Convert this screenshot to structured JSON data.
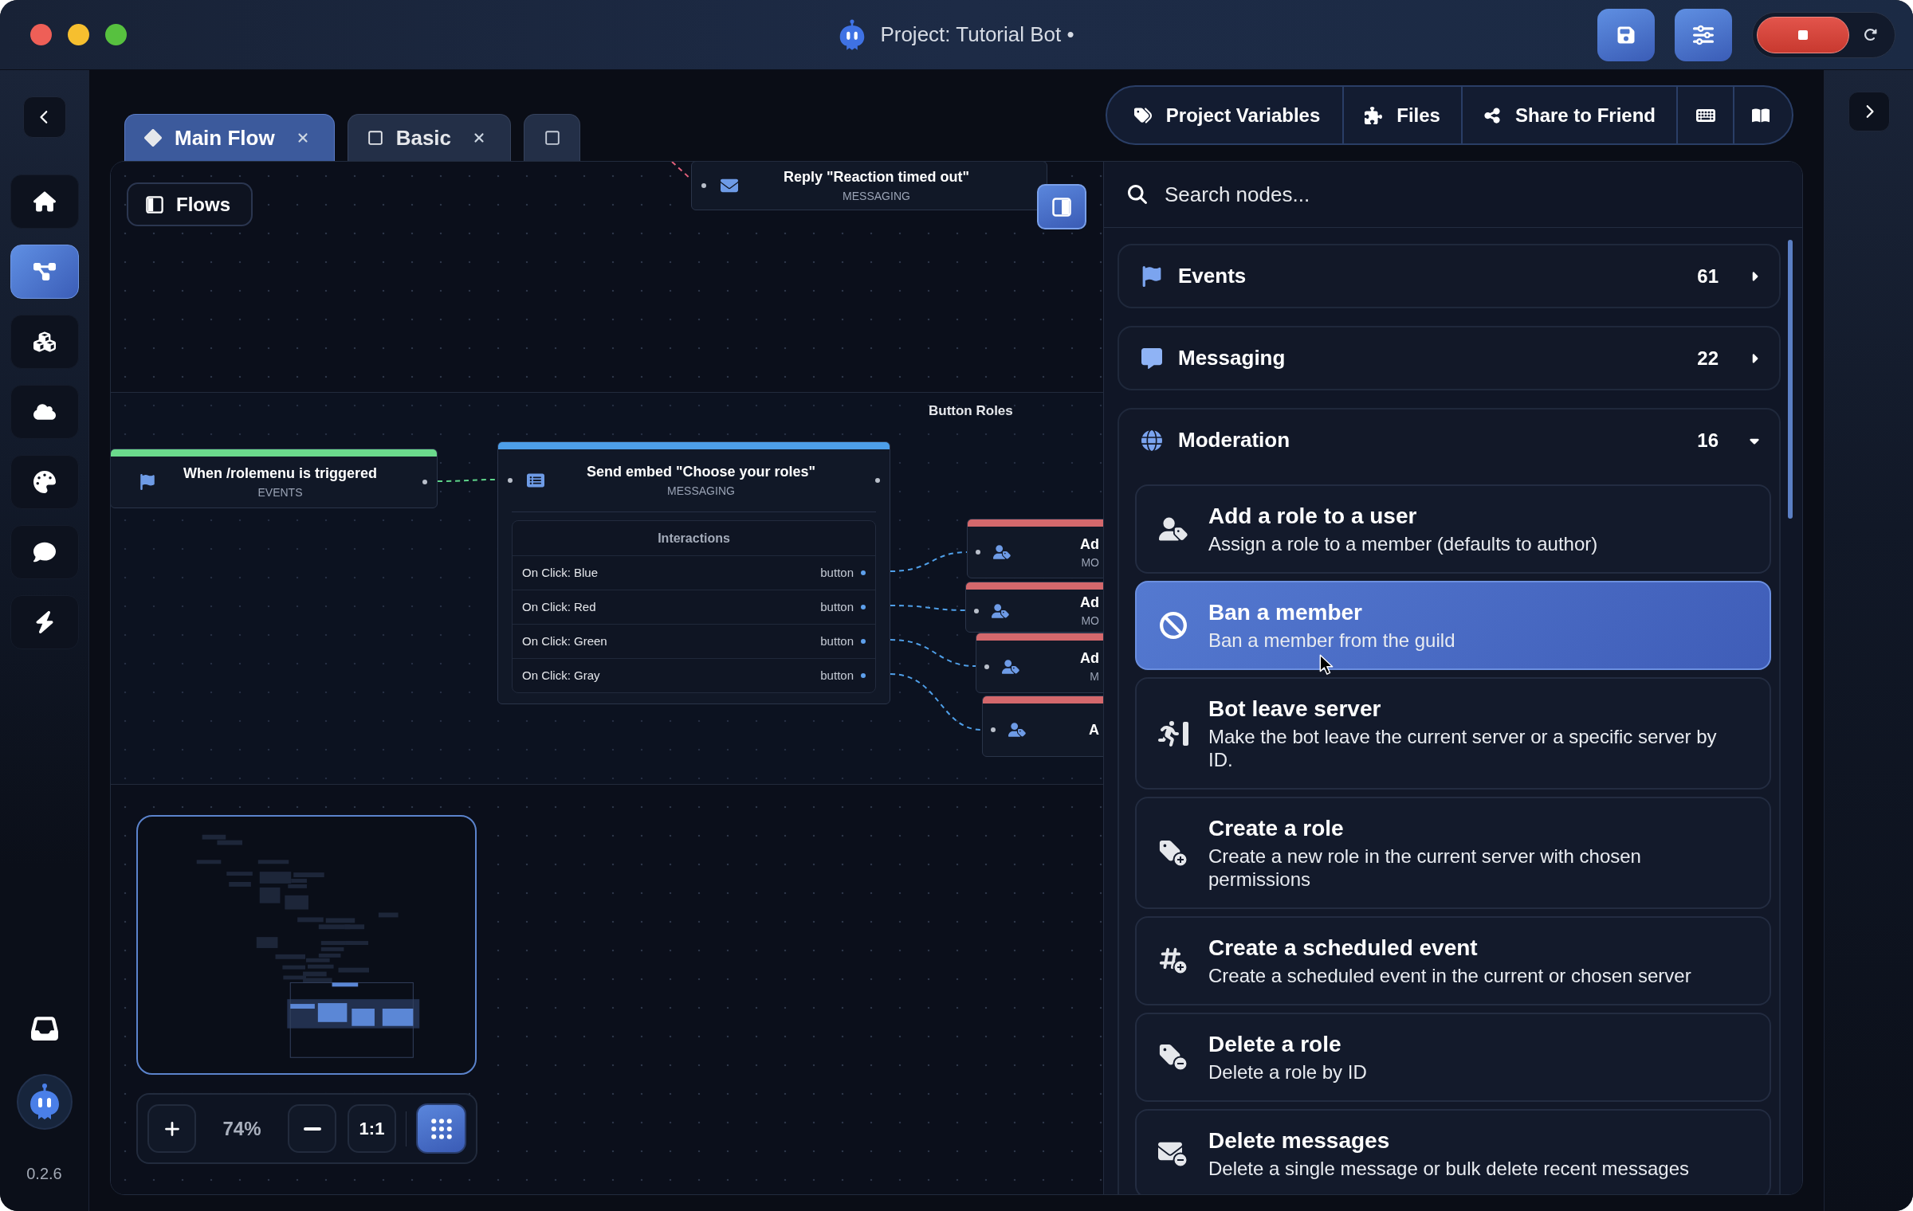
{
  "window": {
    "title": "Project: Tutorial Bot •"
  },
  "sidebar": {
    "items": [
      {
        "selected": false
      },
      {
        "selected": true
      },
      {
        "selected": false
      },
      {
        "selected": false
      },
      {
        "selected": false
      },
      {
        "selected": false
      },
      {
        "selected": false
      }
    ],
    "version": "0.2.6"
  },
  "tabs": [
    {
      "kind": "main",
      "label": "Main Flow",
      "selected": true
    },
    {
      "kind": "flow",
      "label": "Basic",
      "selected": false
    }
  ],
  "toolbar": [
    {
      "label": "Project Variables"
    },
    {
      "label": "Files"
    },
    {
      "label": "Share to Friend"
    }
  ],
  "canvas": {
    "flows_button": "Flows",
    "group_label": "Button Roles",
    "nodes": [
      {
        "title": "Reply \"Reaction timed out\"",
        "category": "MESSAGING"
      },
      {
        "title": "When /rolemenu is triggered",
        "category": "EVENTS",
        "color": "#6bd98c"
      },
      {
        "title": "Send embed \"Choose your roles\"",
        "category": "MESSAGING",
        "color": "#4d9ee8",
        "interactions": {
          "title": "Interactions",
          "rows": [
            {
              "label": "On Click: Blue",
              "type": "button"
            },
            {
              "label": "On Click: Red",
              "type": "button"
            },
            {
              "label": "On Click: Green",
              "type": "button"
            },
            {
              "label": "On Click: Gray",
              "type": "button"
            }
          ]
        }
      },
      {
        "title": "Ad",
        "category": "MO",
        "color": "#d4686c"
      },
      {
        "title": "Ad",
        "category": "MO",
        "color": "#d4686c"
      },
      {
        "title": "Ad",
        "category": "M",
        "color": "#d4686c"
      },
      {
        "title": "A",
        "color": "#d4686c"
      }
    ],
    "zoom": {
      "reading": "74%",
      "reset": "1:1",
      "snap_to_grid": true
    }
  },
  "node_panel": {
    "search": {
      "placeholder": "Search nodes..."
    },
    "categories": [
      {
        "name": "Events",
        "count": "61",
        "expanded": false
      },
      {
        "name": "Messaging",
        "count": "22",
        "expanded": false
      },
      {
        "name": "Moderation",
        "count": "16",
        "expanded": true,
        "items": [
          {
            "title": "Add a role to a user",
            "description": "Assign a role to a member (defaults to author)",
            "selected": false
          },
          {
            "title": "Ban a member",
            "description": "Ban a member from the guild",
            "selected": true
          },
          {
            "title": "Bot leave server",
            "description": "Make the bot leave the current server or a specific server by ID.",
            "selected": false
          },
          {
            "title": "Create a role",
            "description": "Create a new role in the current server with chosen permissions",
            "selected": false
          },
          {
            "title": "Create a scheduled event",
            "description": "Create a scheduled event in the current or chosen server",
            "selected": false
          },
          {
            "title": "Delete a role",
            "description": "Delete a role by ID",
            "selected": false
          },
          {
            "title": "Delete messages",
            "description": "Delete a single message or bulk delete recent messages",
            "selected": false
          }
        ]
      }
    ]
  }
}
